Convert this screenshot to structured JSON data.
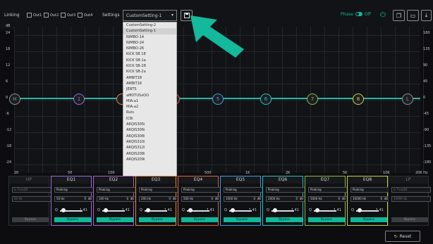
{
  "topbar": {
    "linking": "Linking",
    "outs": [
      "Out1",
      "Out2",
      "Out3",
      "Out4"
    ],
    "settings_label": "Settings",
    "setting_value": "CustomSetting-1",
    "phase_label": "Phase",
    "phase_state": "Off"
  },
  "graph": {
    "y_left": [
      "dB",
      "24",
      "18",
      "12",
      "6",
      "0",
      "-6",
      "-12",
      "-18",
      "-24"
    ],
    "y_right": [
      "180",
      "135",
      "90",
      "45",
      "0",
      "-45",
      "-90",
      "-135",
      "-180"
    ],
    "x_ticks": [
      "20",
      "50",
      "100",
      "200",
      "500",
      "1K",
      "2K",
      "5K",
      "10K",
      "20K Hz"
    ],
    "nodes": [
      {
        "label": "H",
        "color": "#8a8f94"
      },
      {
        "label": "1",
        "color": "#9b6bd6"
      },
      {
        "label": "",
        "color": "#e08c3b"
      },
      {
        "label": "4",
        "color": "#e0603b"
      },
      {
        "label": "5",
        "color": "#3a9fe0"
      },
      {
        "label": "6",
        "color": "#2bc0c0"
      },
      {
        "label": "7",
        "color": "#8cb84a"
      },
      {
        "label": "8",
        "color": "#c9d04a"
      },
      {
        "label": "L",
        "color": "#8a8f94"
      }
    ]
  },
  "dropdown": {
    "items": [
      "CustomSetting-2",
      "CustomSetting-1",
      "NIMBO-14",
      "NIMBO-24",
      "NIMBO-26",
      "KICK SB 18",
      "KICK SB-1a",
      "KICK SB-28",
      "KICK SB-2a",
      "AMBIT18",
      "AMBIT16",
      "JENTS",
      "aMOTUSxOO",
      "MIA-a1",
      "MIA-a2",
      "Ruts",
      "IC8i",
      "ARQIS305i",
      "ARQIS306i",
      "ARQIS308i",
      "ARQIS310i",
      "ARQIS312i",
      "ARQIS208i",
      "ARQIS209i"
    ]
  },
  "eq": {
    "hp": {
      "title": "HP",
      "filter": "Li Tvos48",
      "freq": "20",
      "unit": "Hz",
      "bypass": "Bypass"
    },
    "lp": {
      "title": "LP",
      "filter": "Li Tvos48",
      "freq": "19999",
      "unit": "Hz",
      "bypass": "Bypass"
    },
    "bands": [
      {
        "title": "EQ1",
        "type": "Peaking",
        "freq": "50",
        "unit": "Hz",
        "gain": "0",
        "gunit": "dB",
        "q_label": "Q",
        "q": "1.41",
        "bypass": "Bypass",
        "color": "#9b6bd6"
      },
      {
        "title": "EQ2",
        "type": "Peaking",
        "freq": "100",
        "unit": "Hz",
        "gain": "0",
        "gunit": "dB",
        "q_label": "Q",
        "q": "1.41",
        "bypass": "Bypass",
        "color": "#b05fc8"
      },
      {
        "title": "EQ3",
        "type": "Peaking",
        "freq": "200",
        "unit": "Hz",
        "gain": "0",
        "gunit": "dB",
        "q_label": "Q",
        "q": "1.41",
        "bypass": "Bypass",
        "color": "#e08c3b"
      },
      {
        "title": "EQ4",
        "type": "Peaking",
        "freq": "500",
        "unit": "Hz",
        "gain": "0",
        "gunit": "dB",
        "q_label": "Q",
        "q": "1.41",
        "bypass": "Bypass",
        "color": "#e0603b"
      },
      {
        "title": "EQ5",
        "type": "Peaking",
        "freq": "1000",
        "unit": "Hz",
        "gain": "0",
        "gunit": "dB",
        "q_label": "Q",
        "q": "1.41",
        "bypass": "Bypass",
        "color": "#3a9fe0"
      },
      {
        "title": "EQ6",
        "type": "Peaking",
        "freq": "2000",
        "unit": "Hz",
        "gain": "0",
        "gunit": "dB",
        "q_label": "Q",
        "q": "1.41",
        "bypass": "Bypass",
        "color": "#2bc0c0"
      },
      {
        "title": "EQ7",
        "type": "Peaking",
        "freq": "5000",
        "unit": "Hz",
        "gain": "0",
        "gunit": "dB",
        "q_label": "Q",
        "q": "1.41",
        "bypass": "Bypass",
        "color": "#8cb84a"
      },
      {
        "title": "EQ8",
        "type": "Peaking",
        "freq": "10000",
        "unit": "Hz",
        "gain": "0",
        "gunit": "dB",
        "q_label": "Q",
        "q": "1.41",
        "bypass": "Bypass",
        "color": "#c9d04a"
      }
    ]
  },
  "reset_label": "Reset",
  "colors": {
    "accent": "#0fb89b",
    "curve": "#2ab5a5",
    "arrow": "#14b89a"
  }
}
